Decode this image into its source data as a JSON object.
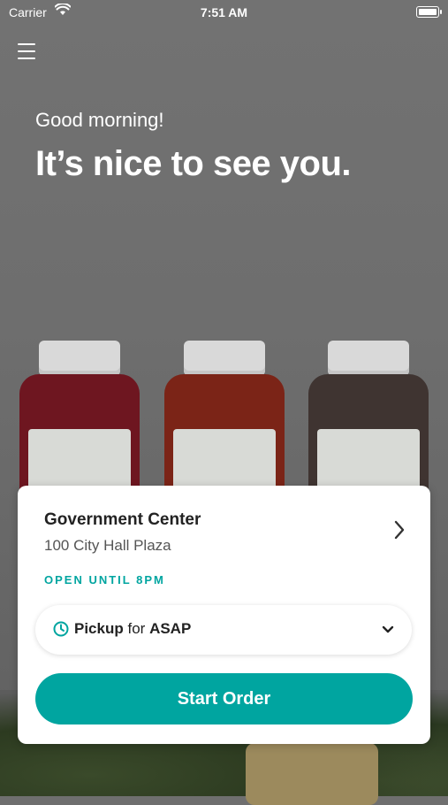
{
  "status_bar": {
    "carrier": "Carrier",
    "time": "7:51 AM"
  },
  "hero": {
    "greeting": "Good morning!",
    "headline": "It’s nice to see you."
  },
  "store": {
    "name": "Government Center",
    "address": "100 City Hall Plaza",
    "hours": "OPEN UNTIL 8PM"
  },
  "order_type": {
    "mode": "Pickup",
    "connector": "for",
    "time": "ASAP"
  },
  "actions": {
    "start_order_label": "Start Order"
  },
  "colors": {
    "accent": "#00a5a0",
    "card_bg": "#ffffff"
  },
  "icons": [
    "wifi-icon",
    "battery-icon",
    "menu-icon",
    "chevron-right-icon",
    "clock-icon",
    "chevron-down-icon"
  ]
}
